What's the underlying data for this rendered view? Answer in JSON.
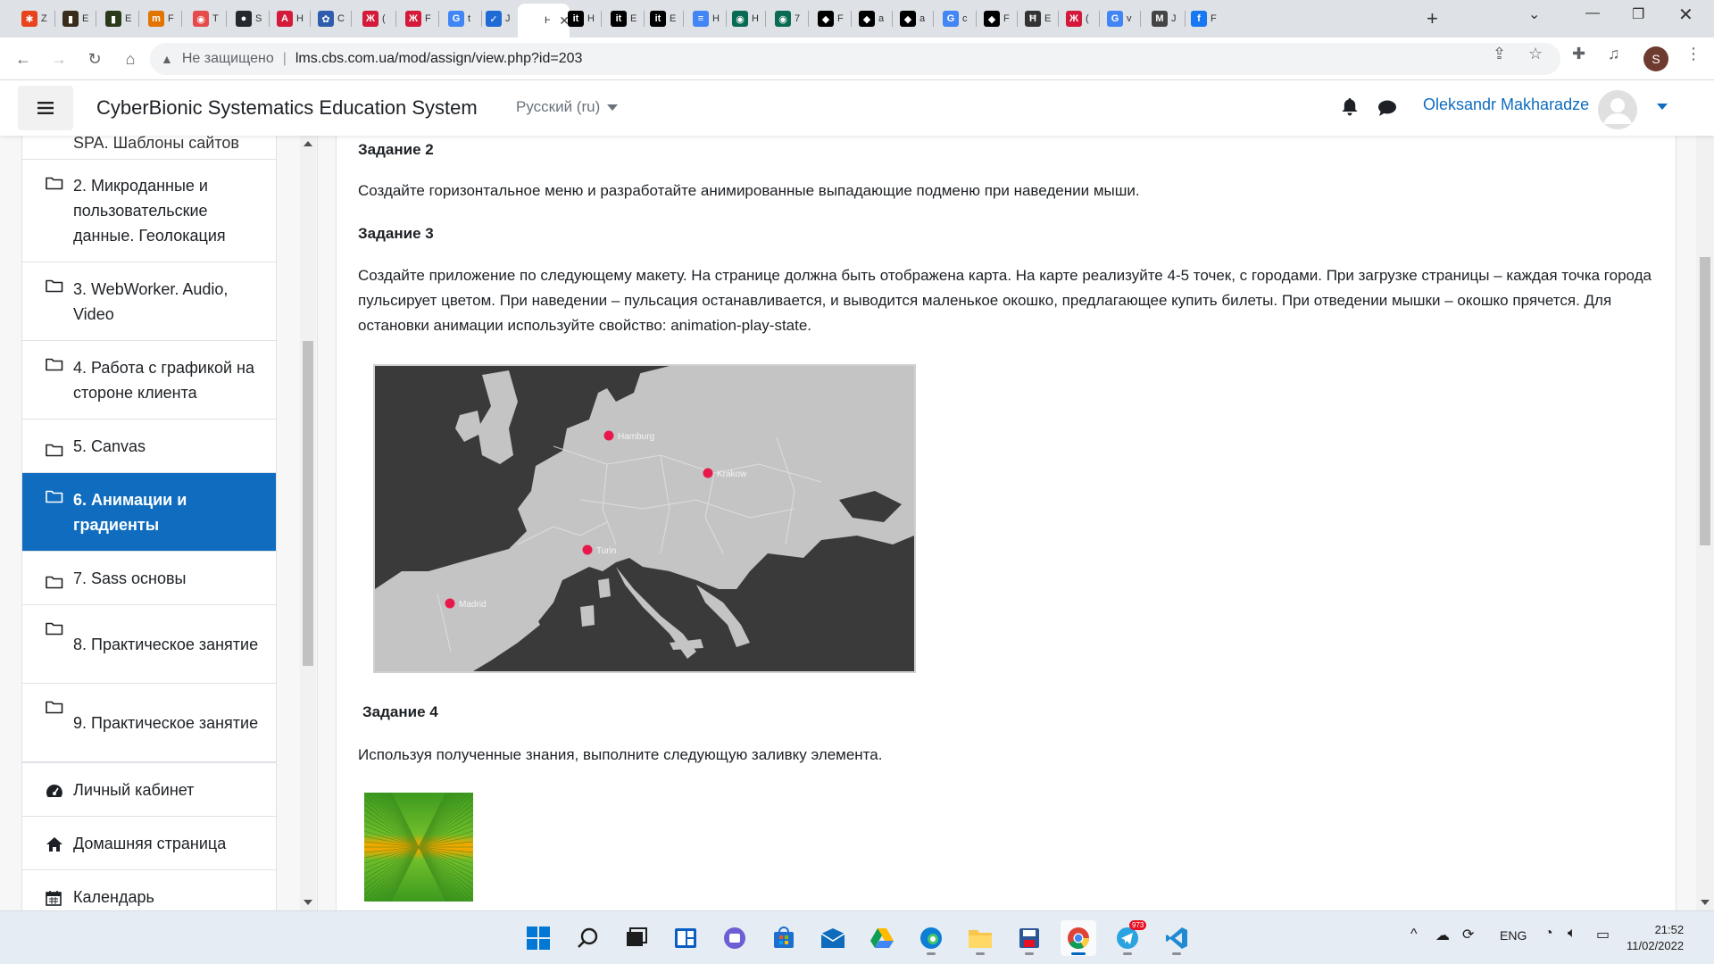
{
  "browser": {
    "tabs": [
      {
        "fav": "✱",
        "color": "#e8431d",
        "title": "Z"
      },
      {
        "fav": "▮",
        "color": "#3a2c1a",
        "title": "E"
      },
      {
        "fav": "▮",
        "color": "#2a3a1a",
        "title": "E"
      },
      {
        "fav": "m",
        "color": "#e37400",
        "title": "F"
      },
      {
        "fav": "◉",
        "color": "#e54b4b",
        "title": "T"
      },
      {
        "fav": "●",
        "color": "#24292f",
        "title": "S"
      },
      {
        "fav": "A",
        "color": "#d4193b",
        "title": "H"
      },
      {
        "fav": "✿",
        "color": "#2f5dad",
        "title": "C"
      },
      {
        "fav": "Ж",
        "color": "#d4193b",
        "title": "("
      },
      {
        "fav": "Ж",
        "color": "#d4193b",
        "title": "F"
      },
      {
        "fav": "G",
        "color": "#4285f4",
        "title": "t"
      },
      {
        "fav": "✓",
        "color": "#1e6bd6",
        "title": "J"
      },
      {
        "fav": "",
        "color": "#ffffff",
        "title": "H",
        "active": true
      },
      {
        "fav": "it",
        "color": "#000000",
        "title": "H"
      },
      {
        "fav": "it",
        "color": "#000000",
        "title": "E"
      },
      {
        "fav": "it",
        "color": "#000000",
        "title": "E"
      },
      {
        "fav": "≡",
        "color": "#4285f4",
        "title": "H"
      },
      {
        "fav": "◉",
        "color": "#0a6b55",
        "title": "H"
      },
      {
        "fav": "◉",
        "color": "#0a6b55",
        "title": "7"
      },
      {
        "fav": "◆",
        "color": "#000000",
        "title": "F"
      },
      {
        "fav": "◆",
        "color": "#000000",
        "title": "a"
      },
      {
        "fav": "◆",
        "color": "#000000",
        "title": "a"
      },
      {
        "fav": "G",
        "color": "#4285f4",
        "title": "c"
      },
      {
        "fav": "◆",
        "color": "#000000",
        "title": "F"
      },
      {
        "fav": "Ħ",
        "color": "#333333",
        "title": "E"
      },
      {
        "fav": "Ж",
        "color": "#d4193b",
        "title": "("
      },
      {
        "fav": "G",
        "color": "#4285f4",
        "title": "v"
      },
      {
        "fav": "M",
        "color": "#444444",
        "title": "J"
      },
      {
        "fav": "f",
        "color": "#1877f2",
        "title": "F"
      }
    ],
    "new_tab": "+",
    "insecure_label": "Не защищено",
    "url": "lms.cbs.com.ua/mod/assign/view.php?id=203",
    "profile_letter": "S"
  },
  "navbar": {
    "site_name": "CyberBionic Systematics Education System",
    "language": "Русский (ru)",
    "user_name": "Oleksandr Makharadze"
  },
  "drawer": {
    "clipped_item": "SPA. Шаблоны сайтов",
    "sections": [
      {
        "label": "2. Микроданные и пользовательские данные. Геолокация"
      },
      {
        "label": "3. WebWorker. Audio, Video"
      },
      {
        "label": "4. Работа с графикой на стороне клиента"
      },
      {
        "label": "5. Canvas"
      },
      {
        "label": "6. Анимации и градиенты",
        "active": true
      },
      {
        "label": "7. Sass основы"
      },
      {
        "label": "8. Практическое занятие"
      },
      {
        "label": "9. Практическое занятие"
      }
    ],
    "links": [
      {
        "label": "Личный кабинет",
        "icon": "dashboard-icon"
      },
      {
        "label": "Домашняя страница",
        "icon": "home-icon"
      },
      {
        "label": "Календарь",
        "icon": "calendar-icon"
      }
    ]
  },
  "main": {
    "task2_title": "Задание 2",
    "task2_text": "Создайте горизонтальное меню и разработайте анимированные выпадающие подменю при наведении мыши.",
    "task3_title": "Задание 3",
    "task3_text": "Создайте приложение по следующему макету. На странице должна быть отображена карта. На карте реализуйте 4-5 точек, с городами. При загрузке страницы – каждая точка города пульсирует цветом. При наведении – пульсация останавливается, и выводится маленькое окошко, предлагающее купить билеты. При отведении мышки – окошко прячется. Для остановки анимации используйте свойство: animation-play-state.",
    "map_cities": [
      "Hamburg",
      "Krakow",
      "Turin",
      "Madrid"
    ],
    "task4_title": "Задание 4",
    "task4_text": "Используя полученные знания, выполните следующую заливку элемента."
  },
  "taskbar": {
    "apps": [
      "start-icon",
      "search-icon",
      "task-view-icon",
      "widgets-icon",
      "teams-chat-icon",
      "store-icon",
      "mail-icon",
      "google-drive-icon",
      "edge-icon",
      "file-explorer-icon",
      "save-icon",
      "chrome-icon",
      "telegram-icon",
      "vscode-icon"
    ],
    "telegram_badge": "973",
    "language": "ENG",
    "time": "21:52",
    "date": "11/02/2022"
  },
  "colors": {
    "accent": "#0f6cbf",
    "map_dot": "#e8194a"
  }
}
